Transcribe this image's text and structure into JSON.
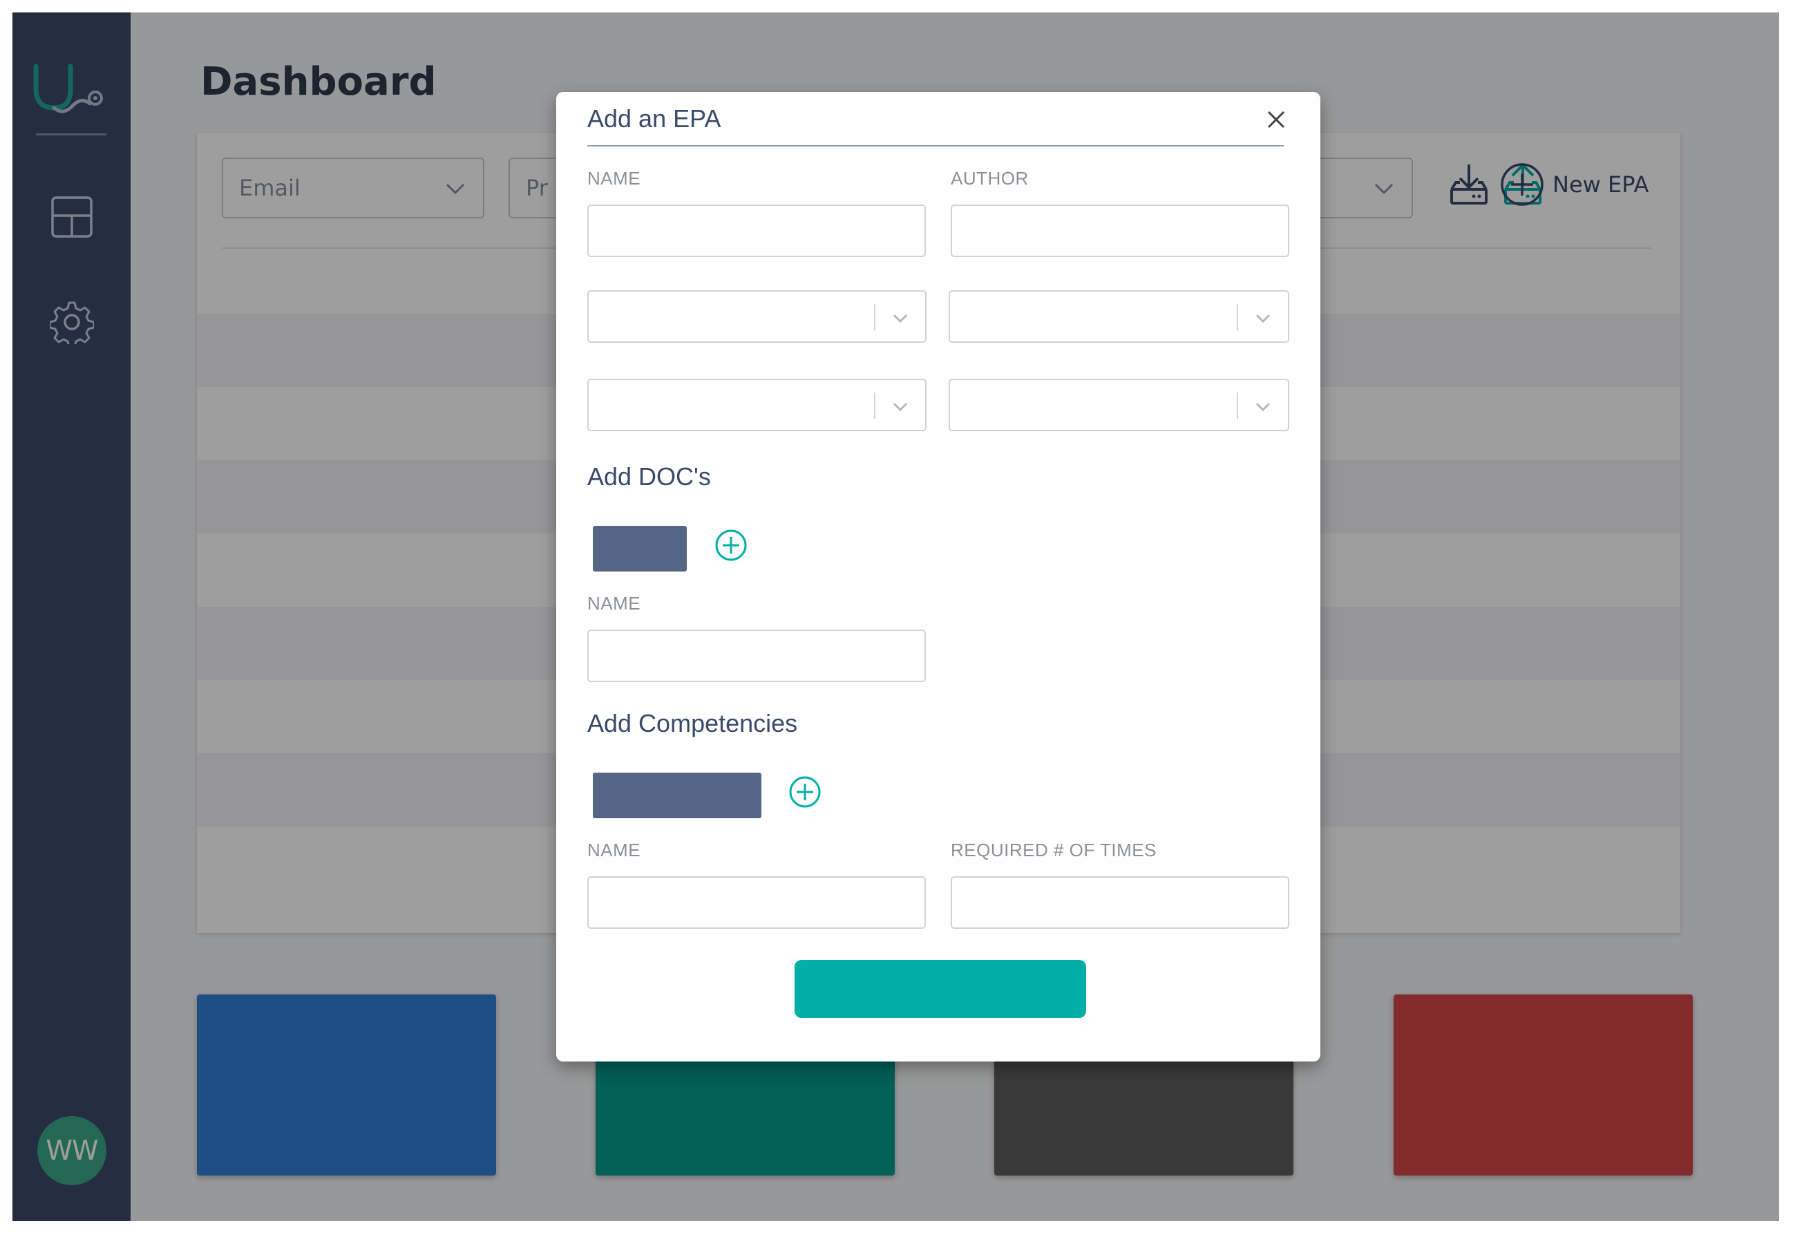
{
  "colors": {
    "sidebar": "#3a4a6b",
    "accent_teal": "#00aea7",
    "card_blue": "#2f7dd2",
    "card_teal": "#009a8c",
    "card_dark": "#5c5c5c",
    "card_red": "#d44447",
    "placeholder_button": "#536686"
  },
  "sidebar": {
    "logo_icon": "stethoscope-logo",
    "items": [
      {
        "icon": "grid-icon",
        "name": "dashboard"
      },
      {
        "icon": "gear-icon",
        "name": "settings"
      }
    ],
    "avatar_initials": "WW"
  },
  "page": {
    "title": "Dashboard"
  },
  "toolbar": {
    "filters": [
      {
        "placeholder": "Email"
      },
      {
        "placeholder": "Pr"
      }
    ],
    "download_icon": "download-icon",
    "upload_icon": "upload-icon",
    "new_epa_label": "New EPA"
  },
  "modal": {
    "title": "Add an EPA",
    "close_icon": "close-icon",
    "name_label": "NAME",
    "author_label": "AUTHOR",
    "name_value": "",
    "author_value": "",
    "docs_title": "Add DOC's",
    "doc_name_label": "NAME",
    "doc_name_value": "",
    "competencies_title": "Add Competencies",
    "comp_name_label": "NAME",
    "comp_required_label": "REQUIRED # OF TIMES",
    "comp_name_value": "",
    "comp_required_value": ""
  }
}
